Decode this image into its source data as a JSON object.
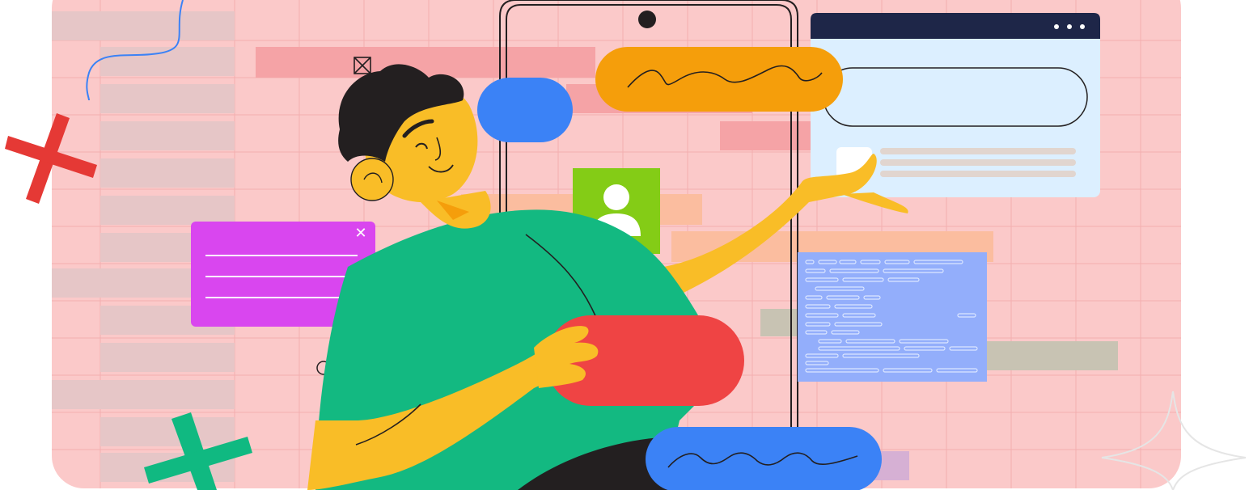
{
  "illustration": {
    "colors": {
      "canvas": "#fbc9c9",
      "grid_line": "#f3a9ab",
      "skin": "#f9bd27",
      "hair": "#231f20",
      "shirt": "#13b981",
      "accent_blue": "#3b82f6",
      "accent_orange": "#f59e0b",
      "accent_red": "#ef4444",
      "accent_green": "#84cc16",
      "accent_magenta": "#d946ef",
      "accent_periwinkle": "#93aefb",
      "browser_header": "#1e2648",
      "browser_body": "#dcefff",
      "cross_red": "#e53935",
      "cross_green": "#10b981"
    },
    "icons": [
      "avatar-icon",
      "close-icon",
      "browser-dots-icon",
      "crossed-box-icon",
      "sparkle-star-icon",
      "plus-cross-icon"
    ]
  }
}
